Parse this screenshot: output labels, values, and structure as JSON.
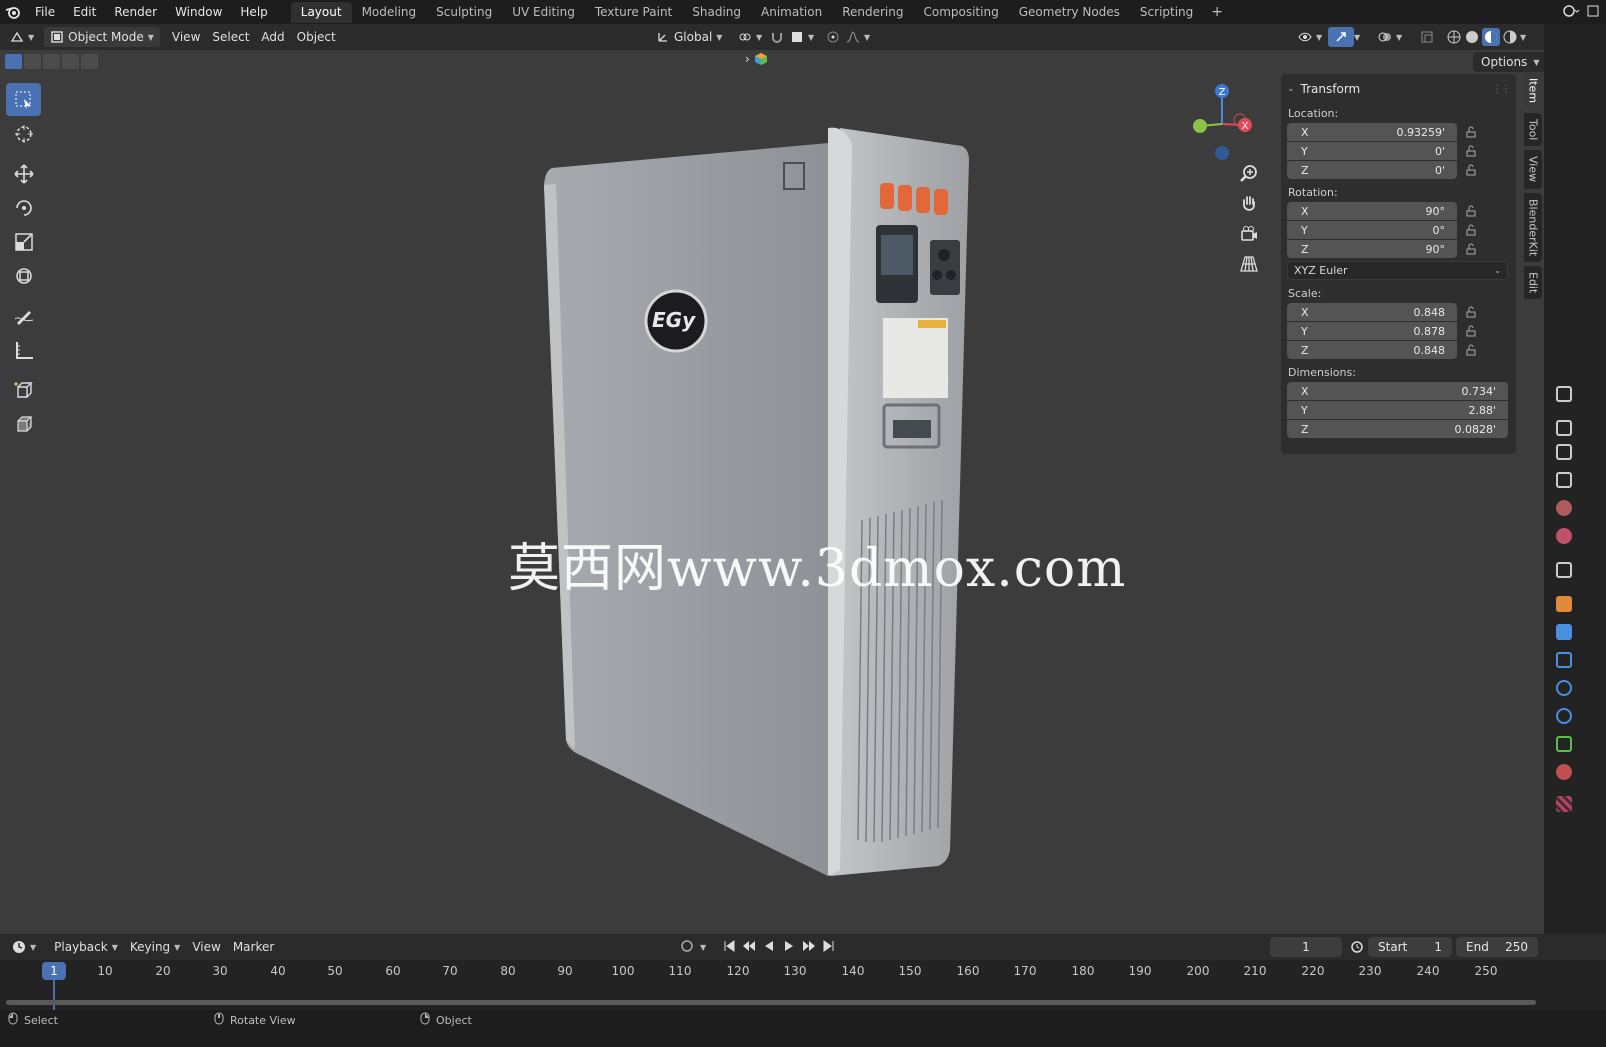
{
  "menu": {
    "items": [
      "File",
      "Edit",
      "Render",
      "Window",
      "Help"
    ]
  },
  "workspaces": {
    "tabs": [
      "Layout",
      "Modeling",
      "Sculpting",
      "UV Editing",
      "Texture Paint",
      "Shading",
      "Animation",
      "Rendering",
      "Compositing",
      "Geometry Nodes",
      "Scripting"
    ],
    "active": "Layout",
    "add": "+"
  },
  "header": {
    "mode": "Object Mode",
    "menus": [
      "View",
      "Select",
      "Add",
      "Object"
    ],
    "orientation": "Global",
    "options": "Options"
  },
  "transform": {
    "title": "Transform",
    "location_label": "Location:",
    "location": [
      {
        "axis": "X",
        "value": "0.93259'"
      },
      {
        "axis": "Y",
        "value": "0'"
      },
      {
        "axis": "Z",
        "value": "0'"
      }
    ],
    "rotation_label": "Rotation:",
    "rotation": [
      {
        "axis": "X",
        "value": "90°"
      },
      {
        "axis": "Y",
        "value": "0°"
      },
      {
        "axis": "Z",
        "value": "90°"
      }
    ],
    "rotation_mode": "XYZ Euler",
    "scale_label": "Scale:",
    "scale": [
      {
        "axis": "X",
        "value": "0.848"
      },
      {
        "axis": "Y",
        "value": "0.878"
      },
      {
        "axis": "Z",
        "value": "0.848"
      }
    ],
    "dimensions_label": "Dimensions:",
    "dimensions": [
      {
        "axis": "X",
        "value": "0.734'"
      },
      {
        "axis": "Y",
        "value": "2.88'"
      },
      {
        "axis": "Z",
        "value": "0.0828'"
      }
    ]
  },
  "sidetabs": [
    "Item",
    "Tool",
    "View",
    "BlenderKit",
    "Edit"
  ],
  "gizmo": {
    "z": "Z",
    "x": "X"
  },
  "model_logo": "EGy",
  "watermark": "莫西网www.3dmox.com",
  "timeline": {
    "menus": [
      "Playback",
      "Keying",
      "View",
      "Marker"
    ],
    "current_frame": "1",
    "start_label": "Start",
    "start": "1",
    "end_label": "End",
    "end": "250",
    "ticks": [
      "1",
      "10",
      "20",
      "30",
      "40",
      "50",
      "60",
      "70",
      "80",
      "90",
      "100",
      "110",
      "120",
      "130",
      "140",
      "150",
      "160",
      "170",
      "180",
      "190",
      "200",
      "210",
      "220",
      "230",
      "240",
      "250"
    ]
  },
  "status": {
    "select": "Select",
    "rotate": "Rotate View",
    "object": "Object"
  },
  "colors": {
    "accent": "#4a72b2",
    "panel": "#2e2e2e",
    "viewport": "#3c3c3c"
  }
}
